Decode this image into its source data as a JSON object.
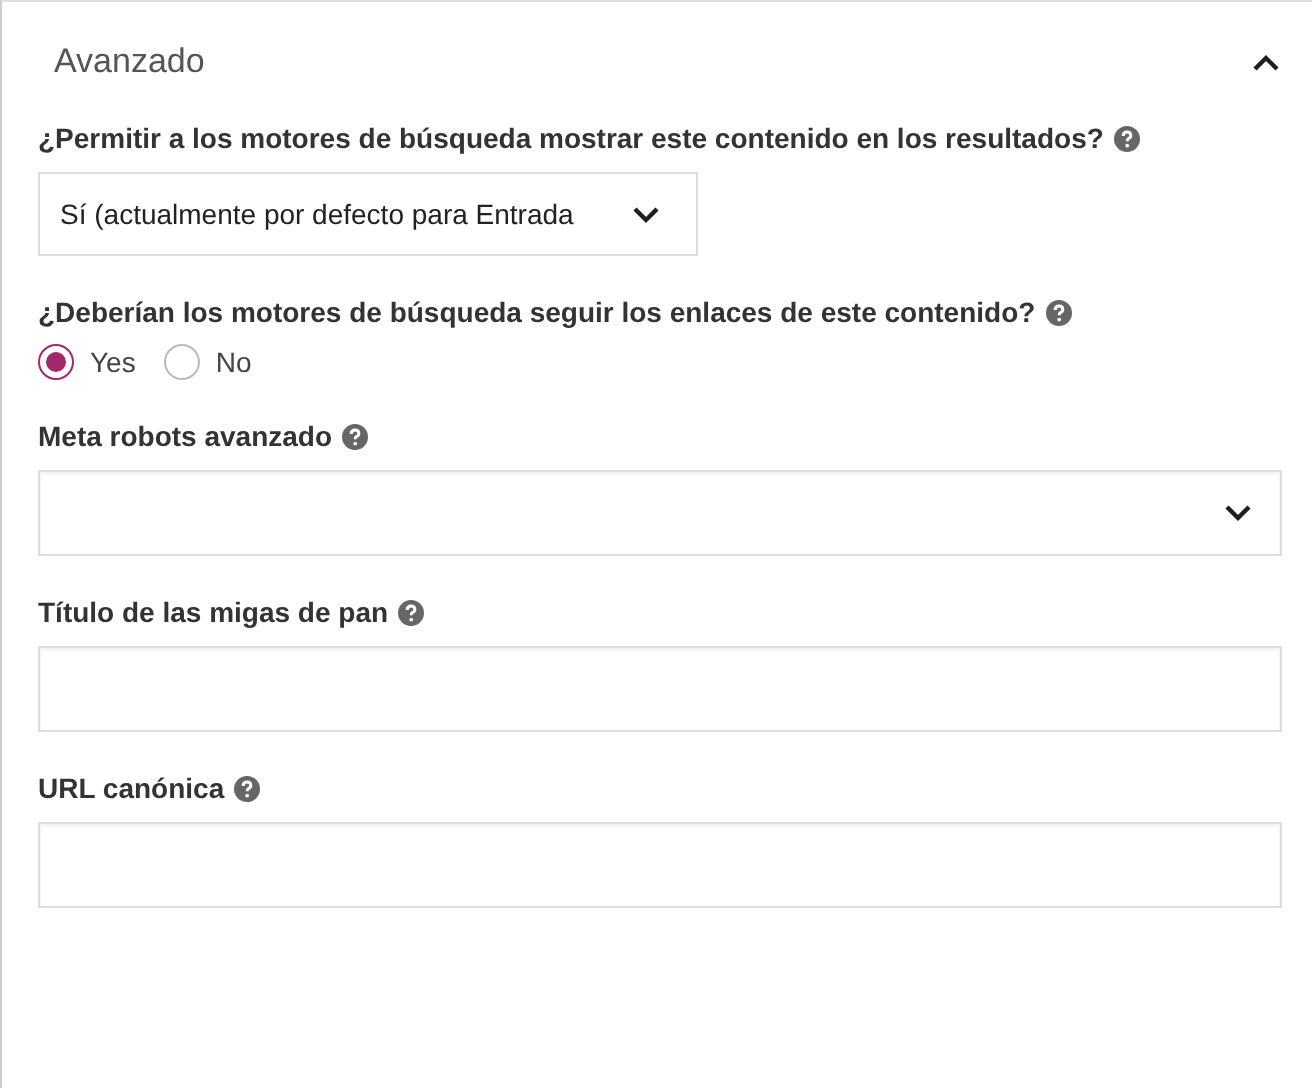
{
  "panel": {
    "title": "Avanzado",
    "expanded": true
  },
  "fields": [
    {
      "kind": "select",
      "label": "¿Permitir a los motores de búsqueda mostrar este contenido en los resultados?",
      "value": "Sí (actualmente por defecto para Entrada"
    },
    {
      "kind": "radio",
      "label": "¿Deberían los motores de búsqueda seguir los enlaces de este contenido?",
      "options": [
        {
          "label": "Yes",
          "selected": true
        },
        {
          "label": "No",
          "selected": false
        }
      ]
    },
    {
      "kind": "multiselect",
      "label": "Meta robots avanzado"
    },
    {
      "kind": "text",
      "label": "Título de las migas de pan"
    },
    {
      "kind": "text",
      "label": "URL canónica"
    }
  ]
}
